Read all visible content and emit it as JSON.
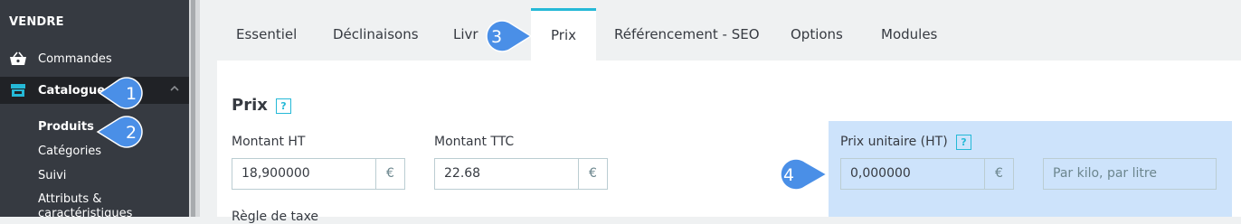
{
  "sidebar": {
    "section_title": "VENDRE",
    "orders_label": "Commandes",
    "catalog_label": "Catalogue",
    "sub_items": [
      "Produits",
      "Catégories",
      "Suivi",
      "Attributs &",
      "caractéristiques"
    ]
  },
  "tabs": [
    "Essentiel",
    "Déclinaisons",
    "Livr",
    "Prix",
    "Référencement - SEO",
    "Options",
    "Modules"
  ],
  "active_tab": "Prix",
  "prix": {
    "title": "Prix",
    "help_glyph": "?",
    "ht_label": "Montant HT",
    "ht_value": "18,900000",
    "ttc_label": "Montant TTC",
    "ttc_value": "22.68",
    "currency": "€",
    "unit_label": "Prix unitaire (HT)",
    "unit_value": "0,000000",
    "unit_placeholder": "Par kilo, par litre",
    "tax_rule_label": "Règle de taxe"
  },
  "callouts": [
    "1",
    "2",
    "3",
    "4"
  ],
  "colors": {
    "sidebar": "#363a41",
    "accent": "#25b9d7",
    "callout": "#4a8fe7",
    "highlight": "#cde3fb"
  }
}
